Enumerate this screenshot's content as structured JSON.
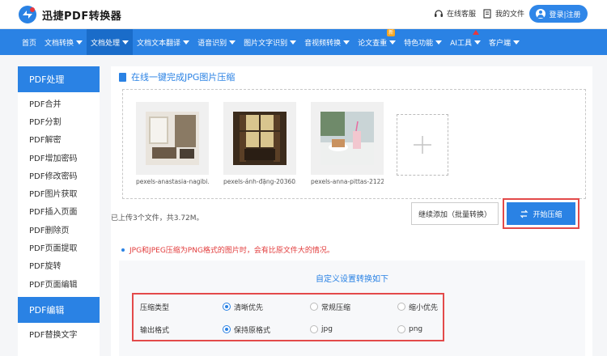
{
  "brand": {
    "name": "迅捷PDF转换器"
  },
  "header": {
    "service_label": "在线客服",
    "files_label": "我的文件",
    "login_label": "登录|注册"
  },
  "nav": {
    "items": [
      {
        "label": "首页"
      },
      {
        "label": "文档转换"
      },
      {
        "label": "文档处理"
      },
      {
        "label": "文档文本翻译"
      },
      {
        "label": "语音识别"
      },
      {
        "label": "图片文字识别"
      },
      {
        "label": "音视频转换"
      },
      {
        "label": "论文查重"
      },
      {
        "label": "特色功能"
      },
      {
        "label": "AI工具"
      },
      {
        "label": "客户端"
      }
    ],
    "new_badge": "新"
  },
  "sidebar": {
    "group1_title": "PDF处理",
    "group1_items": [
      "PDF合并",
      "PDF分割",
      "PDF解密",
      "PDF增加密码",
      "PDF修改密码",
      "PDF图片获取",
      "PDF插入页面",
      "PDF删除页",
      "PDF页面提取",
      "PDF旋转",
      "PDF页面编辑"
    ],
    "group2_title": "PDF编辑",
    "group2_items": [
      "PDF替换文字"
    ]
  },
  "main": {
    "title": "在线一键完成JPG图片压缩",
    "files": [
      {
        "name": "pexels-anastasia-nagibi..."
      },
      {
        "name": "pexels-ánh-đặng-20360..."
      },
      {
        "name": "pexels-anna-pittas-2122..."
      }
    ],
    "add_icon": "plus-icon",
    "status": "已上传3个文件，共3.72M。",
    "add_more_label": "继续添加（批量转换）",
    "start_label": "开始压缩",
    "note": "JPG和JPEG压缩为PNG格式的图片时，会有比原文件大的情况。",
    "settings_title": "自定义设置转换如下",
    "compress_type": {
      "label": "压缩类型",
      "options": [
        "清晰优先",
        "常规压缩",
        "缩小优先"
      ],
      "selected": "清晰优先"
    },
    "output_format": {
      "label": "输出格式",
      "options": [
        "保持原格式",
        "jpg",
        "png"
      ],
      "selected": "保持原格式"
    }
  },
  "colors": {
    "primary": "#2a82e4",
    "highlight_border": "#e34a4a",
    "note": "#e23b3b"
  }
}
